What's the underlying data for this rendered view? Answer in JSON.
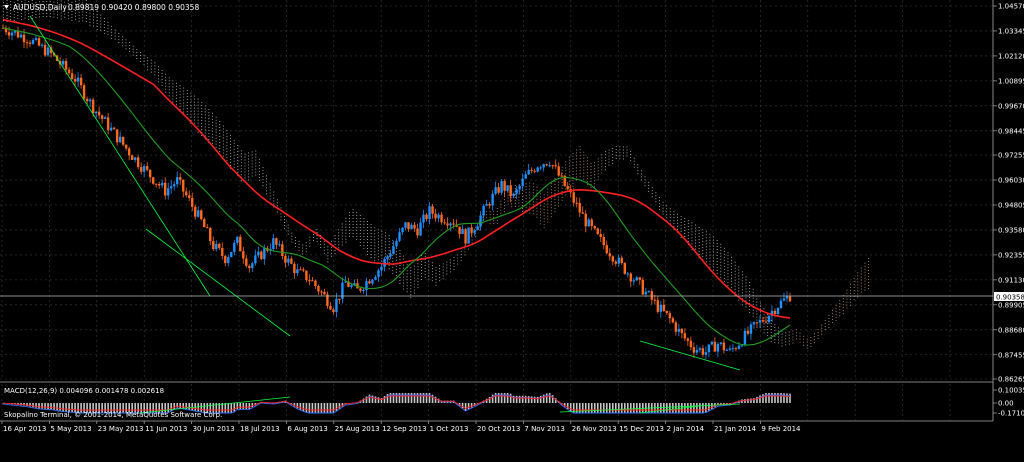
{
  "window": {
    "title_symbol": "AUDUSD,Daily",
    "title_values": "0.89819 0.90420 0.89800 0.90358",
    "copyright": "Skopalino Terminal, © 2001-2014, MetaQuotes Software Corp."
  },
  "price_axis": {
    "ticks": [
      "1.04570",
      "1.03345",
      "1.02120",
      "1.00895",
      "0.99670",
      "0.98445",
      "0.97255",
      "0.96030",
      "0.94805",
      "0.93580",
      "0.92355",
      "0.91130",
      "0.89905",
      "0.88680",
      "0.87455",
      "0.86265"
    ],
    "current_price": "0.90358",
    "ylim": [
      0.86265,
      1.0457
    ]
  },
  "macd": {
    "title": "MACD(12,26,9) 0.004096 0.001478 0.002618",
    "ticks": [
      "0.10035",
      "0.00",
      "-0.17109"
    ]
  },
  "date_axis": {
    "labels": [
      "16 Apr 2013",
      "5 May 2013",
      "23 May 2013",
      "11 Jun 2013",
      "30 Jun 2013",
      "18 Jul 2013",
      "6 Aug 2013",
      "25 Aug 2013",
      "12 Sep 2013",
      "1 Oct 2013",
      "20 Oct 2013",
      "7 Nov 2013",
      "26 Nov 2013",
      "15 Dec 2013",
      "2 Jan 2014",
      "21 Jan 2014",
      "9 Feb 2014"
    ]
  },
  "colors": {
    "background": "#000000",
    "grid": "#3c3c3c",
    "candle_up": "#1e90ff",
    "candle_down": "#ff6a1e",
    "ma_slow": "#ff2020",
    "ma_fast": "#1f9e1f",
    "cloud_bear": "#ffffff",
    "cloud_bull": "#ffcfa0",
    "macd_hist": "#c8c8c8",
    "macd_line": "#3070ff",
    "macd_signal": "#ff2020",
    "divergence": "#00ff40"
  },
  "chart_data": {
    "type": "candlestick",
    "symbol": "AUDUSD",
    "timeframe": "Daily",
    "close_path": [
      [
        0,
        1.035
      ],
      [
        8,
        1.03
      ],
      [
        16,
        1.022
      ],
      [
        24,
        1.01
      ],
      [
        30,
        0.996
      ],
      [
        36,
        0.985
      ],
      [
        42,
        0.974
      ],
      [
        48,
        0.964
      ],
      [
        54,
        0.955
      ],
      [
        58,
        0.96
      ],
      [
        62,
        0.95
      ],
      [
        66,
        0.94
      ],
      [
        70,
        0.928
      ],
      [
        74,
        0.922
      ],
      [
        78,
        0.93
      ],
      [
        82,
        0.918
      ],
      [
        86,
        0.924
      ],
      [
        90,
        0.93
      ],
      [
        94,
        0.922
      ],
      [
        98,
        0.915
      ],
      [
        102,
        0.912
      ],
      [
        106,
        0.905
      ],
      [
        110,
        0.898
      ],
      [
        114,
        0.91
      ],
      [
        118,
        0.906
      ],
      [
        122,
        0.912
      ],
      [
        126,
        0.918
      ],
      [
        130,
        0.928
      ],
      [
        134,
        0.938
      ],
      [
        138,
        0.936
      ],
      [
        142,
        0.945
      ],
      [
        146,
        0.942
      ],
      [
        150,
        0.94
      ],
      [
        154,
        0.932
      ],
      [
        158,
        0.94
      ],
      [
        162,
        0.95
      ],
      [
        166,
        0.958
      ],
      [
        170,
        0.952
      ],
      [
        174,
        0.962
      ],
      [
        178,
        0.968
      ],
      [
        182,
        0.97
      ],
      [
        186,
        0.96
      ],
      [
        190,
        0.95
      ],
      [
        194,
        0.94
      ],
      [
        198,
        0.932
      ],
      [
        202,
        0.925
      ],
      [
        206,
        0.918
      ],
      [
        210,
        0.912
      ],
      [
        214,
        0.905
      ],
      [
        218,
        0.898
      ],
      [
        222,
        0.892
      ],
      [
        226,
        0.884
      ],
      [
        230,
        0.878
      ],
      [
        234,
        0.876
      ],
      [
        238,
        0.88
      ],
      [
        242,
        0.876
      ],
      [
        246,
        0.882
      ],
      [
        250,
        0.888
      ],
      [
        254,
        0.893
      ],
      [
        258,
        0.899
      ],
      [
        262,
        0.9036
      ]
    ]
  }
}
